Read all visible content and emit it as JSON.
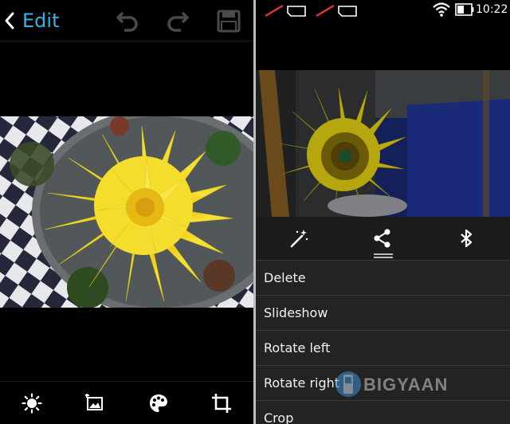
{
  "left": {
    "header": {
      "title": "Edit",
      "icons": [
        "back-arrow-icon",
        "undo-icon",
        "redo-icon",
        "save-icon"
      ]
    },
    "toolbar": {
      "icons": [
        "brightness-icon",
        "image-frame-icon",
        "palette-icon",
        "crop-icon"
      ]
    }
  },
  "right": {
    "status_bar": {
      "time": "10:22",
      "icons": [
        "no-sim-icon",
        "no-sim-icon",
        "wifi-icon",
        "battery-icon"
      ]
    },
    "share_bar": {
      "icons": [
        "magic-wand-icon",
        "share-icon",
        "bluetooth-icon"
      ]
    },
    "menu": {
      "items": [
        "Delete",
        "Slideshow",
        "Rotate left",
        "Rotate right",
        "Crop"
      ]
    }
  },
  "watermark": {
    "text": "BIGYAAN"
  },
  "colors": {
    "accent": "#33b5e5",
    "background": "#000000",
    "menu_background": "#232323",
    "flower_yellow": "#f5e02a"
  }
}
